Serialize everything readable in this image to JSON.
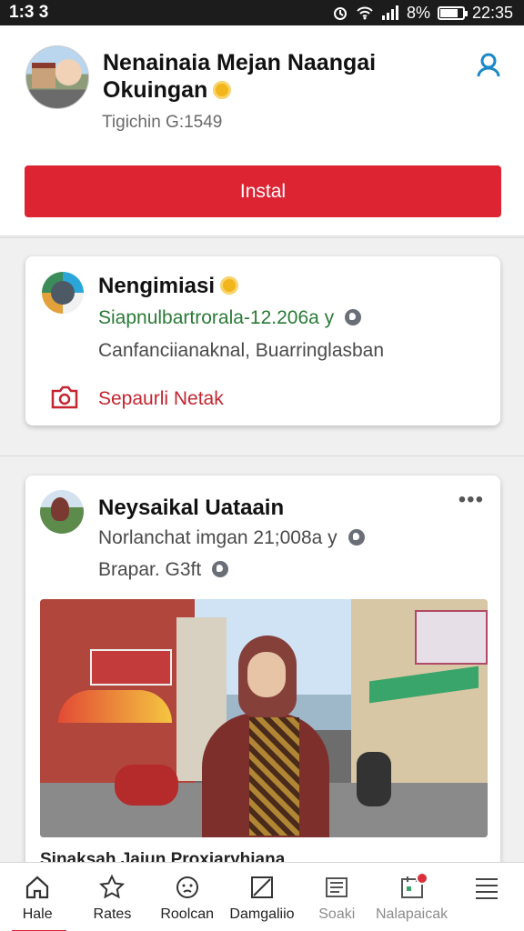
{
  "status_bar": {
    "time": "1:3 3",
    "battery": "8%",
    "clock": "22:35",
    "battery_level": 0.8
  },
  "profile": {
    "name": "Nenainaia Mejan Naangai Okuingan",
    "subtitle": "Tigichin G:1549",
    "install_label": "Instal",
    "icons": [
      "sun-icon",
      "person-icon"
    ]
  },
  "post1": {
    "title": "Nengimiasi",
    "meta": "Siapnulbartrorala-12.206a y",
    "location": "Canfanciianaknal, Buarringlasban",
    "action": "Sepaurli Netak"
  },
  "post2": {
    "title": "Neysaikal Uataain",
    "meta": "Norlanchat imgan 21;008a y",
    "sub": "Brapar. G3ft",
    "caption": "Sinaksah Jaiun Proxiaryhiana"
  },
  "nav": [
    {
      "label": "Hale",
      "icon": "home-icon"
    },
    {
      "label": "Rates",
      "icon": "star-icon"
    },
    {
      "label": "Roolcan",
      "icon": "face-icon"
    },
    {
      "label": "Damgaliio",
      "icon": "chart-icon"
    },
    {
      "label": "Soaki",
      "icon": "news-icon"
    },
    {
      "label": "Nalapaicak",
      "icon": "calendar-icon"
    },
    {
      "label": "",
      "icon": "menu-icon"
    }
  ],
  "colors": {
    "accent": "#dc2433",
    "green_text": "#2a7a37",
    "blue_icon": "#1a88c9"
  }
}
